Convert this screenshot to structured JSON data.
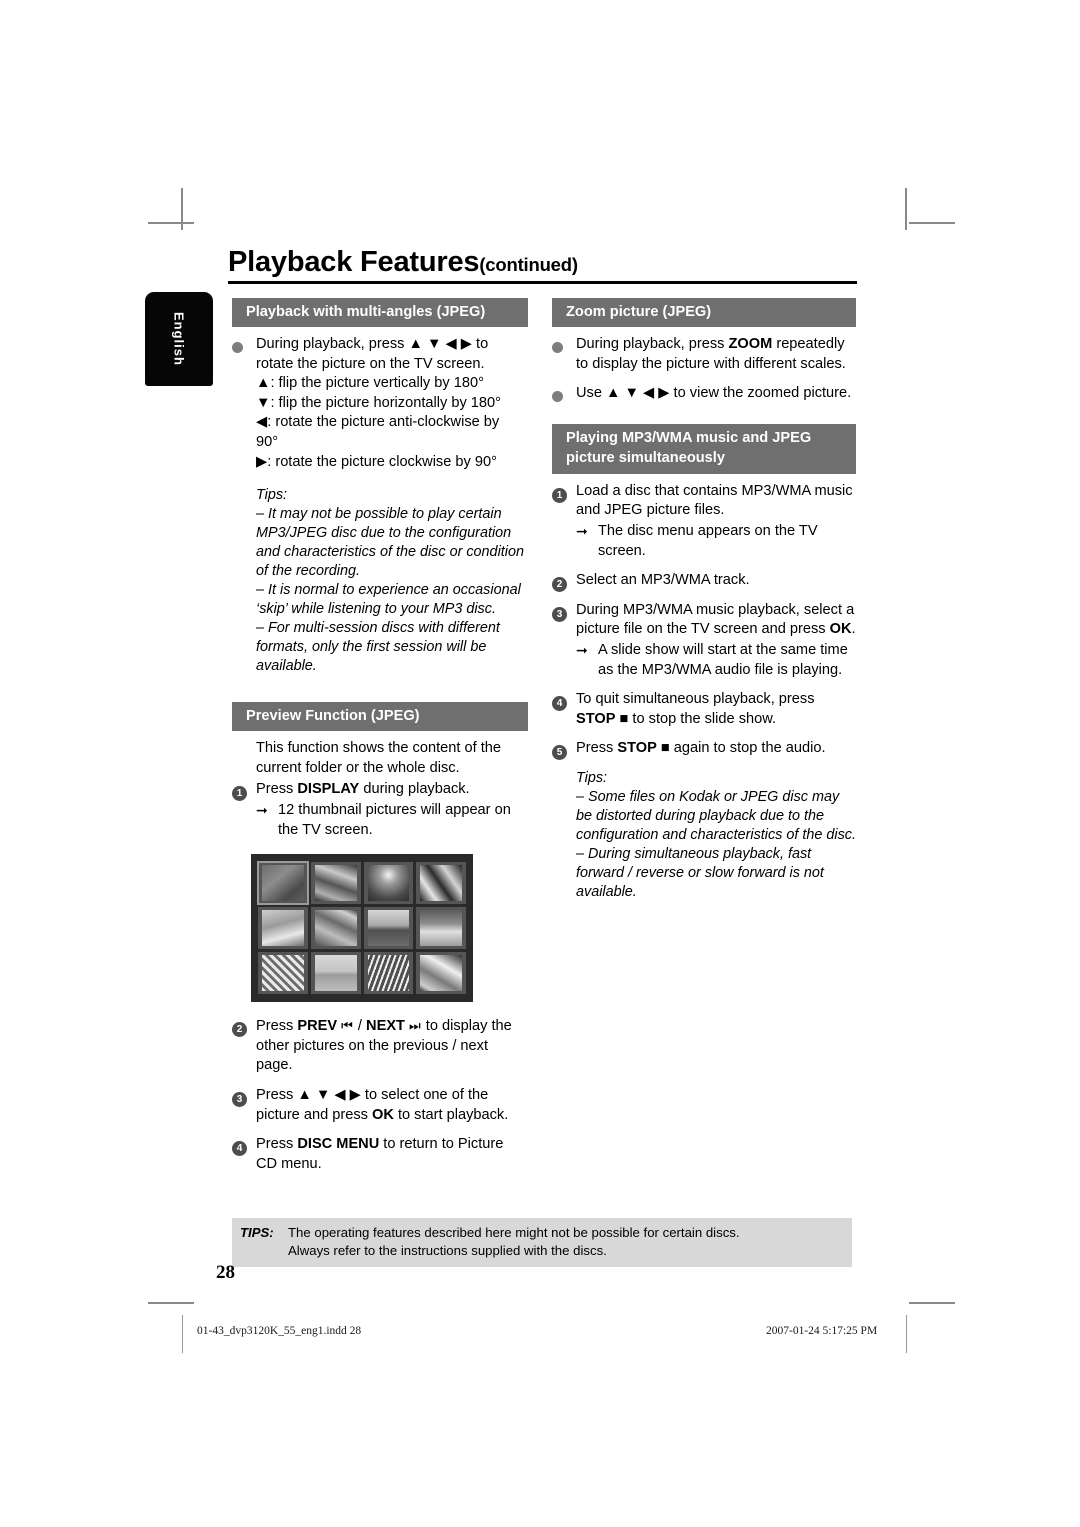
{
  "page": {
    "title_main": "Playback Features",
    "title_continued": "(continued)",
    "language_tab": "English",
    "page_number": "28"
  },
  "left_column": {
    "section1": {
      "heading": "Playback with multi-angles (JPEG)",
      "bullet1_line1": "During playback, press ▲ ▼ ◀ ▶ to",
      "bullet1_line2": "rotate the picture on the TV screen.",
      "bullet1_line3": "▲: flip the picture vertically by 180°",
      "bullet1_line4": "▼: flip the picture horizontally by 180°",
      "bullet1_line5": "◀: rotate the picture anti-clockwise by",
      "bullet1_line6": "90°",
      "bullet1_line7": "▶: rotate the picture clockwise by 90°",
      "tips_label": "Tips:",
      "tip1": "–  It may not be possible to play certain MP3/JPEG disc due to the configuration and characteristics of the disc or condition of the recording.",
      "tip2": "–  It is normal to experience an occasional ‘skip’ while listening to your MP3 disc.",
      "tip3": "–  For multi-session discs with different formats, only the first session will be available."
    },
    "section2": {
      "heading": "Preview Function (JPEG)",
      "intro": "This function shows the content of the current folder or the whole disc.",
      "step1_num": "1",
      "step1_pre": "Press ",
      "step1_key": "DISPLAY",
      "step1_post": " during playback.",
      "step1_sub": "12 thumbnail pictures will appear on the TV screen.",
      "step2_num": "2",
      "step2_pre": "Press ",
      "step2_key1": "PREV",
      "step2_glyph1": "⏮",
      "step2_mid": " / ",
      "step2_key2": "NEXT",
      "step2_glyph2": "⏭",
      "step2_post": " to display the other pictures on the previous / next page.",
      "step3_num": "3",
      "step3_pre": "Press ▲ ▼ ◀ ▶ to select one of the picture and press ",
      "step3_key": "OK",
      "step3_post": " to start playback.",
      "step4_num": "4",
      "step4_pre": "Press ",
      "step4_key": "DISC MENU",
      "step4_post": " to return to Picture CD menu."
    },
    "thumbnail_image": {
      "name": "preview-thumbnail-grid",
      "columns": 4,
      "rows": 3,
      "background": "#2a2a2a",
      "selected_index": 0
    }
  },
  "right_column": {
    "section1": {
      "heading": "Zoom picture (JPEG)",
      "bullet1_pre": "During playback, press ",
      "bullet1_key": "ZOOM",
      "bullet1_post": " repeatedly to display the picture with different scales.",
      "bullet2": "Use ▲ ▼ ◀ ▶ to view the zoomed picture."
    },
    "section2": {
      "heading_line1": "Playing MP3/WMA music and JPEG",
      "heading_line2": "picture simultaneously",
      "step1_num": "1",
      "step1": "Load a disc that contains MP3/WMA music and JPEG picture files.",
      "step1_sub": "The disc menu appears on the TV screen.",
      "step2_num": "2",
      "step2": "Select an MP3/WMA track.",
      "step3_num": "3",
      "step3_pre": "During MP3/WMA music playback, select a picture file on the TV screen and press ",
      "step3_key": "OK",
      "step3_post": ".",
      "step3_sub": "A slide show will start at the same time as the MP3/WMA audio file is playing.",
      "step4_num": "4",
      "step4_pre": "To quit simultaneous playback, press ",
      "step4_key": "STOP",
      "step4_glyph": "■",
      "step4_post": " to stop the slide show.",
      "step5_num": "5",
      "step5_pre": "Press ",
      "step5_key": "STOP",
      "step5_glyph": "■",
      "step5_post": " again to stop the audio.",
      "tips_label": "Tips:",
      "tip1": "–  Some files on Kodak or JPEG disc may be distorted during playback due to the configuration and characteristics of the disc.",
      "tip2": "–  During simultaneous playback, fast forward / reverse or slow forward is not available."
    }
  },
  "footer": {
    "tips_label": "TIPS:",
    "tips_line1": "The operating features described here might not be possible for certain discs.",
    "tips_line2": "Always refer to the instructions supplied with the discs.",
    "file_name": "01-43_dvp3120K_55_eng1.indd   28",
    "timestamp": "2007-01-24   5:17:25 PM"
  },
  "colors": {
    "section_header_bg": "#6f6f6f",
    "tips_box_bg": "#d8d8d8",
    "tab_bg": "#060606",
    "bullet_dot": "#7d7d7d",
    "number_circle": "#4d4d4d"
  }
}
